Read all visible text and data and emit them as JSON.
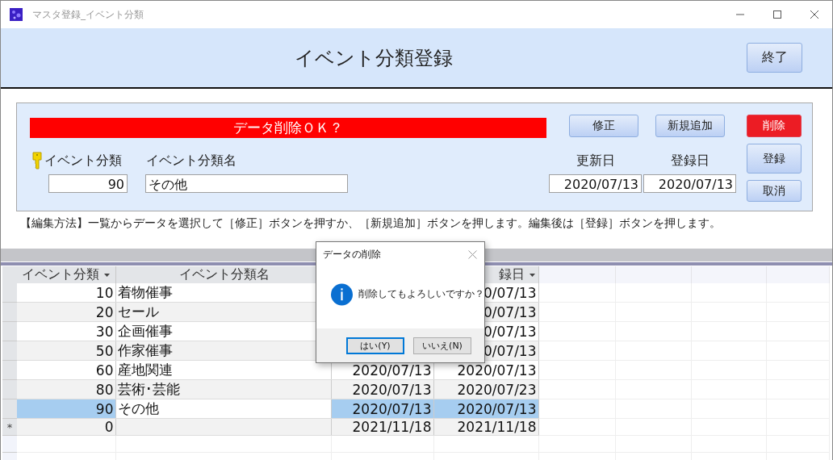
{
  "window": {
    "title": "マスタ登録_イベント分類"
  },
  "header": {
    "title": "イベント分類登録",
    "exit_button": "終了"
  },
  "form": {
    "message": "データ削除ＯＫ？",
    "top_buttons": [
      {
        "label": "修正",
        "kind": "normal"
      },
      {
        "label": "新規追加",
        "kind": "normal"
      },
      {
        "label": "削除",
        "kind": "danger"
      }
    ],
    "side_buttons": [
      {
        "label": "登録",
        "kind": "tall"
      },
      {
        "label": "取消",
        "kind": "normal"
      }
    ],
    "fields": [
      {
        "label": "イベント分類",
        "value": "90",
        "kind": "key"
      },
      {
        "label": "イベント分類名",
        "value": "その他",
        "kind": "text"
      }
    ],
    "dates": [
      {
        "label": "更新日",
        "value": "2020/07/13"
      },
      {
        "label": "登録日",
        "value": "2020/07/13"
      }
    ]
  },
  "instructions": "【編集方法】一覧からデータを選択して［修正］ボタンを押すか、［新規追加］ボタンを押します。編集後は［登録］ボタンを押します。",
  "table": {
    "columns": [
      {
        "label": "イベント分類",
        "sort_menu": true
      },
      {
        "label": "イベント分類名",
        "sort_menu": false
      },
      {},
      {
        "label": "録日",
        "sort_menu": true
      }
    ],
    "rows": [
      {
        "selected": false,
        "kind": "record",
        "cells": [
          "10",
          "着物催事",
          "",
          "0/07/13"
        ]
      },
      {
        "selected": false,
        "kind": "record",
        "cells": [
          "20",
          "セール",
          "",
          "0/07/13"
        ]
      },
      {
        "selected": false,
        "kind": "record",
        "cells": [
          "30",
          "企画催事",
          "",
          "0/07/13"
        ]
      },
      {
        "selected": false,
        "kind": "record",
        "cells": [
          "50",
          "作家催事",
          "",
          "0/07/13"
        ]
      },
      {
        "selected": false,
        "kind": "record",
        "cells": [
          "60",
          "産地関連",
          "2020/07/13",
          "2020/07/13"
        ]
      },
      {
        "selected": false,
        "kind": "record",
        "cells": [
          "80",
          "芸術･芸能",
          "2020/07/13",
          "2020/07/23"
        ]
      },
      {
        "selected": true,
        "kind": "record",
        "cells": [
          "90",
          "その他",
          "2020/07/13",
          "2020/07/13"
        ]
      },
      {
        "selected": false,
        "kind": "new",
        "marker": "*",
        "cells": [
          "0",
          "",
          "2021/11/18",
          "2021/11/18"
        ]
      }
    ]
  },
  "dialog": {
    "title": "データの削除",
    "message": "削除してもよろしいですか？",
    "buttons": [
      {
        "label": "はい(Y)",
        "selected": true
      },
      {
        "label": "いいえ(N)",
        "selected": false
      }
    ]
  }
}
